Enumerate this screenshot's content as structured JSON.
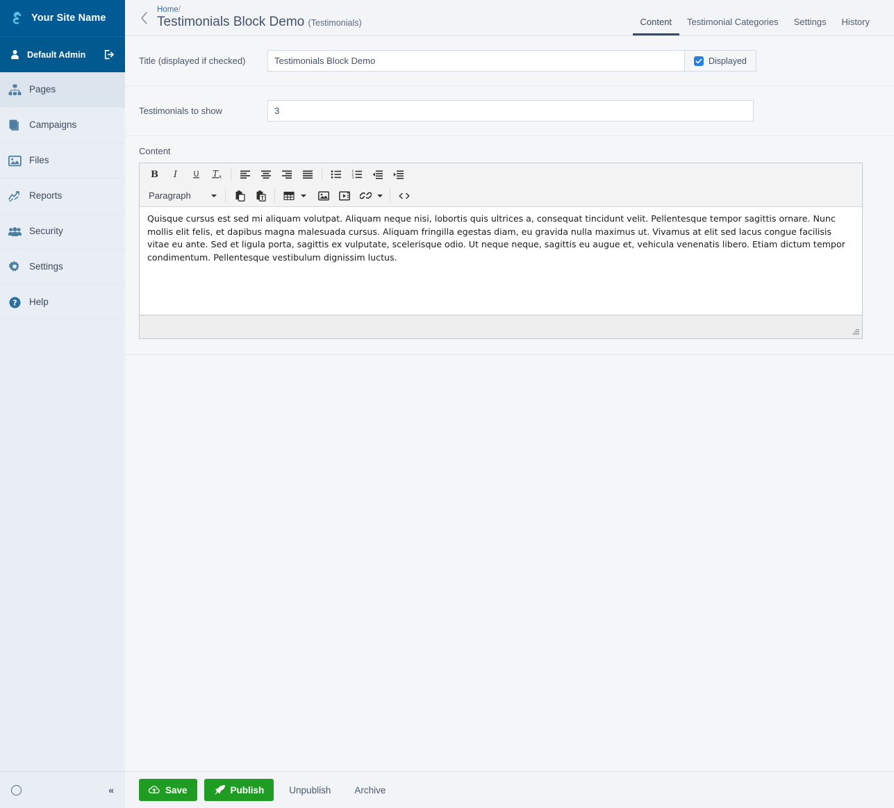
{
  "sidebar": {
    "brand": {
      "name": "Your Site Name",
      "logo_icon": "silverstripe-logo-icon"
    },
    "profile": {
      "name": "Default Admin",
      "user_icon": "user-icon",
      "logout_icon": "logout-icon"
    },
    "items": [
      {
        "label": "Pages",
        "icon": "sitemap-icon",
        "active": true
      },
      {
        "label": "Campaigns",
        "icon": "campaigns-stack-icon",
        "active": false
      },
      {
        "label": "Files",
        "icon": "image-files-icon",
        "active": false
      },
      {
        "label": "Reports",
        "icon": "chart-line-icon",
        "active": false
      },
      {
        "label": "Security",
        "icon": "users-group-icon",
        "active": false
      },
      {
        "label": "Settings",
        "icon": "gear-icon",
        "active": false
      },
      {
        "label": "Help",
        "icon": "question-circle-icon",
        "active": false
      }
    ],
    "footer": {
      "spinner_icon": "loading-circle-icon",
      "collapse_label": "«"
    }
  },
  "header": {
    "back_icon": "chevron-left-icon",
    "breadcrumb": {
      "home_label": "Home",
      "separator": "/"
    },
    "title": "Testimonials Block Demo",
    "title_subtype": "(Testimonials)",
    "tabs": [
      {
        "label": "Content",
        "active": true
      },
      {
        "label": "Testimonial Categories",
        "active": false
      },
      {
        "label": "Settings",
        "active": false
      },
      {
        "label": "History",
        "active": false
      }
    ]
  },
  "form": {
    "title_field": {
      "label": "Title (displayed if checked)",
      "value": "Testimonials Block Demo",
      "placeholder": "",
      "checkbox_label": "Displayed",
      "checkbox_checked": true,
      "check_icon": "check-icon"
    },
    "count_field": {
      "label": "Testimonials to show",
      "value": "3",
      "placeholder": ""
    },
    "content_field": {
      "label": "Content",
      "body_text": "Quisque cursus est sed mi aliquam volutpat. Aliquam neque nisi, lobortis quis ultrices a, consequat tincidunt velit. Pellentesque tempor sagittis ornare. Nunc mollis elit felis, et dapibus magna malesuada cursus. Aliquam fringilla egestas diam, eu gravida nulla maximus ut. Vivamus at elit sed lacus congue facilisis vitae eu ante. Sed et ligula porta, sagittis ex vulputate, scelerisque odio. Ut neque neque, sagittis eu augue et, vehicula venenatis libero. Etiam dictum tempor condimentum. Pellentesque vestibulum dignissim luctus.",
      "toolbar": {
        "row1": [
          {
            "name": "bold-icon",
            "title": "Bold"
          },
          {
            "name": "italic-icon",
            "title": "Italic"
          },
          {
            "name": "underline-icon",
            "title": "Underline"
          },
          {
            "name": "remove-format-icon",
            "title": "Clear formatting"
          },
          {
            "name": "separator",
            "title": ""
          },
          {
            "name": "align-left-icon",
            "title": "Align left"
          },
          {
            "name": "align-center-icon",
            "title": "Align center"
          },
          {
            "name": "align-right-icon",
            "title": "Align right"
          },
          {
            "name": "align-justify-icon",
            "title": "Justify"
          },
          {
            "name": "separator",
            "title": ""
          },
          {
            "name": "bullet-list-icon",
            "title": "Bullet list"
          },
          {
            "name": "numbered-list-icon",
            "title": "Numbered list"
          },
          {
            "name": "outdent-icon",
            "title": "Decrease indent"
          },
          {
            "name": "indent-icon",
            "title": "Increase indent"
          }
        ],
        "format_select": "Paragraph",
        "row2": [
          {
            "name": "paste-icon",
            "title": "Paste"
          },
          {
            "name": "paste-as-text-icon",
            "title": "Paste as text"
          },
          {
            "name": "separator",
            "title": ""
          },
          {
            "name": "table-icon",
            "title": "Table",
            "caret": true
          },
          {
            "name": "insert-image-icon",
            "title": "Insert image"
          },
          {
            "name": "insert-media-icon",
            "title": "Insert media"
          },
          {
            "name": "insert-link-icon",
            "title": "Insert link",
            "caret": true
          },
          {
            "name": "separator",
            "title": ""
          },
          {
            "name": "source-code-icon",
            "title": "Source code"
          }
        ]
      },
      "resize_grip_icon": "resize-grip-icon"
    }
  },
  "actions": {
    "save": {
      "label": "Save",
      "icon": "cloud-upload-icon"
    },
    "publish": {
      "label": "Publish",
      "icon": "rocket-icon"
    },
    "unpublish": {
      "label": "Unpublish"
    },
    "archive": {
      "label": "Archive"
    }
  },
  "colors": {
    "brand_blue": "#005a93",
    "profile_blue": "#00598f",
    "sidebar_bg": "#e9eef4",
    "sidebar_active": "#dce4ed",
    "accent_link": "#2b6fbd",
    "checkbox_blue": "#2b7fe0",
    "button_green": "#1f9c22",
    "main_bg": "#f5f6f8",
    "tab_active_underline": "#3a4a5f"
  }
}
